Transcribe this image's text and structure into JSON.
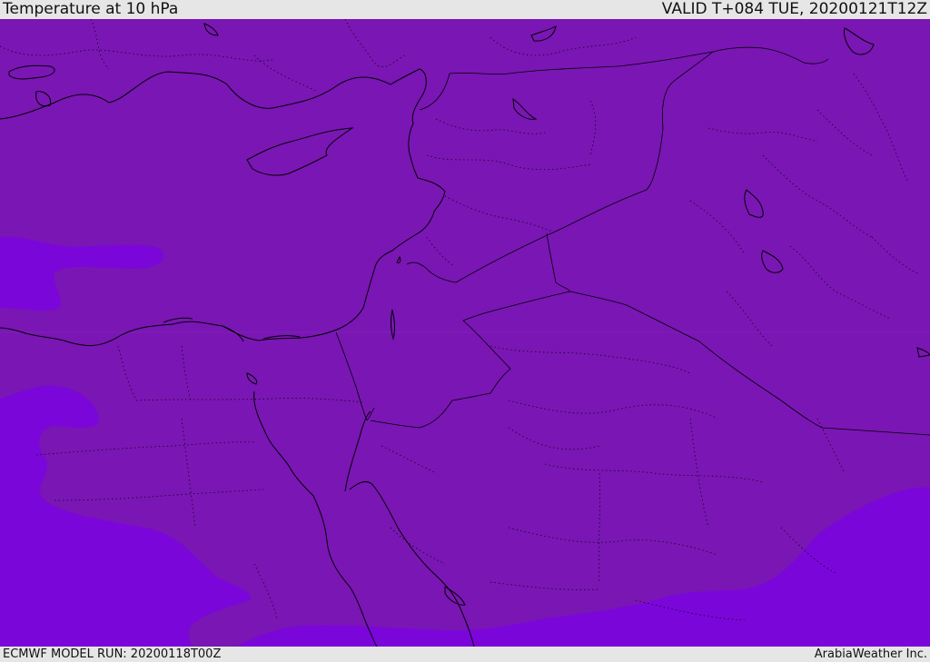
{
  "header": {
    "title": "Temperature at 10 hPa",
    "valid_time": "VALID T+084 TUE, 20200121T12Z"
  },
  "footer": {
    "model_run": "ECMWF MODEL RUN: 20200118T00Z",
    "credit": "ArabiaWeather Inc."
  },
  "map": {
    "colors": {
      "warmer_field": "#7a16b4",
      "colder_field": "#7b06d9",
      "coastline": "#000000",
      "borders": "#000000"
    }
  }
}
